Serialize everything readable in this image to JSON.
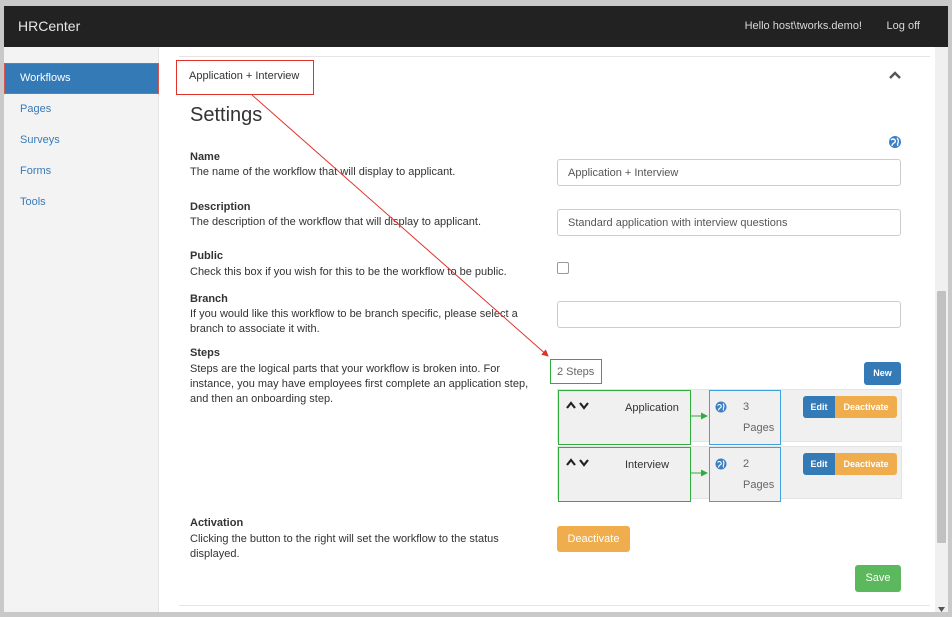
{
  "navbar": {
    "brand": "HRCenter",
    "greeting": "Hello host\\tworks.demo!",
    "logoff": "Log off"
  },
  "sidebar": {
    "items": [
      {
        "label": "Workflows",
        "active": true
      },
      {
        "label": "Pages"
      },
      {
        "label": "Surveys"
      },
      {
        "label": "Forms"
      },
      {
        "label": "Tools"
      }
    ]
  },
  "workflow": {
    "title": "Application + Interview",
    "collapse_icon": "chevron-up-icon"
  },
  "settings": {
    "heading": "Settings",
    "globe_icon": "globe-icon",
    "name": {
      "label": "Name",
      "desc": "The name of the workflow that will display to applicant.",
      "value": "Application + Interview"
    },
    "description": {
      "label": "Description",
      "desc": "The description of the workflow that will display to applicant.",
      "value": "Standard application with interview questions"
    },
    "public": {
      "label": "Public",
      "desc": "Check this box if you wish for this to be the workflow to be public.",
      "checked": false
    },
    "branch": {
      "label": "Branch",
      "desc": "If you would like this workflow to be branch specific, please select a branch to associate it with.",
      "value": ""
    },
    "steps": {
      "label": "Steps",
      "desc": "Steps are the logical parts that your workflow is broken into. For instance, you may have employees first complete an application step, and then an onboarding step.",
      "count_label": "2 Steps",
      "new_label": "New",
      "items": [
        {
          "name": "Application",
          "pages_count": "3",
          "pages_word": "Pages",
          "edit_label": "Edit",
          "deactivate_label": "Deactivate"
        },
        {
          "name": "Interview",
          "pages_count": "2",
          "pages_word": "Pages",
          "edit_label": "Edit",
          "deactivate_label": "Deactivate"
        }
      ]
    },
    "activation": {
      "label": "Activation",
      "desc": "Clicking the button to the right will set the workflow to the status displayed.",
      "button_label": "Deactivate"
    },
    "save_label": "Save"
  },
  "colors": {
    "navbar": "#222222",
    "primary": "#337ab7",
    "warning": "#f0ad4e",
    "success": "#5cb85c",
    "annotation_red": "#e0312b",
    "annotation_green": "#2eae3a",
    "annotation_blue": "#3ca3dc"
  }
}
